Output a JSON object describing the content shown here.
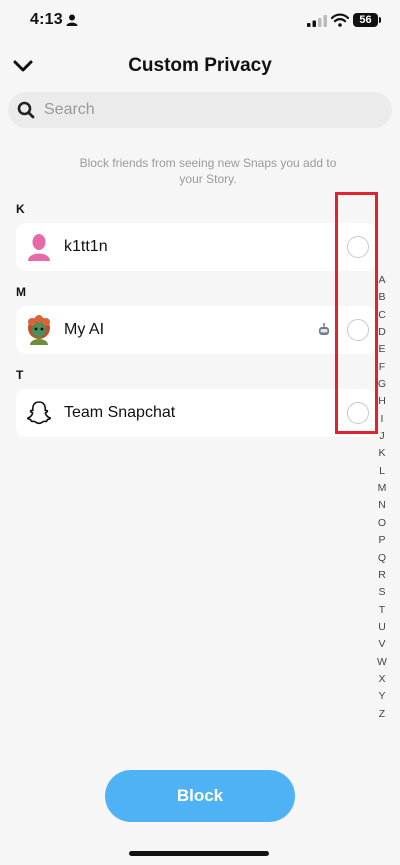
{
  "status_bar": {
    "time": "4:13",
    "battery": "56"
  },
  "header": {
    "title": "Custom Privacy"
  },
  "search": {
    "placeholder": "Search"
  },
  "description": "Block friends from seeing new Snaps you add to your Story.",
  "sections": [
    {
      "letter": "K",
      "rows": [
        {
          "name": "k1tt1n",
          "avatar": "bitmoji-silhouette-pink",
          "selected": false
        }
      ]
    },
    {
      "letter": "M",
      "rows": [
        {
          "name": "My AI",
          "avatar": "my-ai-avatar",
          "badge": "robot-icon",
          "selected": false
        }
      ]
    },
    {
      "letter": "T",
      "rows": [
        {
          "name": "Team Snapchat",
          "avatar": "snapchat-ghost-icon",
          "selected": false
        }
      ]
    }
  ],
  "alphabet_index": [
    "A",
    "B",
    "C",
    "D",
    "E",
    "F",
    "G",
    "H",
    "I",
    "J",
    "K",
    "L",
    "M",
    "N",
    "O",
    "P",
    "Q",
    "R",
    "S",
    "T",
    "U",
    "V",
    "W",
    "X",
    "Y",
    "Z"
  ],
  "block_button": {
    "label": "Block",
    "color": "#4fb2f4"
  },
  "colors": {
    "highlight": "#e1222f",
    "background": "#f6f6f6"
  }
}
